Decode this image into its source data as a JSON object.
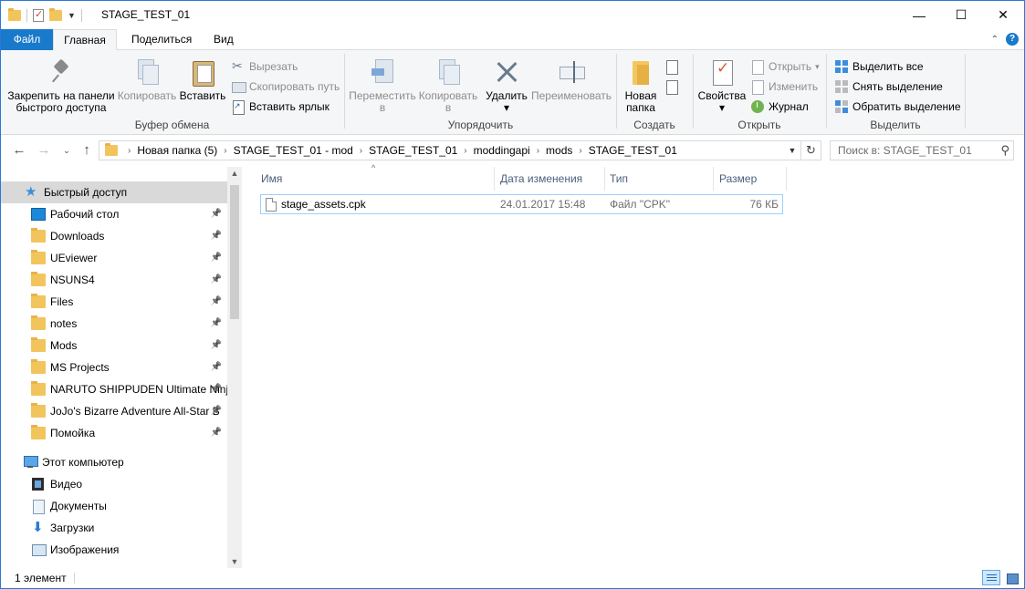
{
  "window": {
    "title": "STAGE_TEST_01",
    "controls": {
      "minimize": "—",
      "maximize": "☐",
      "close": "✕"
    }
  },
  "ribbon_tabs": {
    "file": "Файл",
    "home": "Главная",
    "share": "Поделиться",
    "view": "Вид"
  },
  "ribbon": {
    "clipboard": {
      "label": "Буфер обмена",
      "pin_line1": "Закрепить на панели",
      "pin_line2": "быстрого доступа",
      "copy": "Копировать",
      "paste": "Вставить",
      "cut": "Вырезать",
      "copy_path": "Скопировать путь",
      "paste_shortcut": "Вставить ярлык"
    },
    "organize": {
      "label": "Упорядочить",
      "move_line1": "Переместить",
      "move_line2": "в",
      "copy_line1": "Копировать",
      "copy_line2": "в",
      "delete": "Удалить",
      "rename": "Переименовать"
    },
    "create": {
      "label": "Создать",
      "new_folder_line1": "Новая",
      "new_folder_line2": "папка"
    },
    "open": {
      "label": "Открыть",
      "properties": "Свойства",
      "open": "Открыть",
      "edit": "Изменить",
      "history": "Журнал"
    },
    "select": {
      "label": "Выделить",
      "select_all": "Выделить все",
      "select_none": "Снять выделение",
      "invert": "Обратить выделение"
    }
  },
  "address": {
    "crumbs": [
      "Новая папка (5)",
      "STAGE_TEST_01 - mod",
      "STAGE_TEST_01",
      "moddingapi",
      "mods",
      "STAGE_TEST_01"
    ],
    "search_placeholder": "Поиск в: STAGE_TEST_01"
  },
  "nav_pane": {
    "quick_access": "Быстрый доступ",
    "quick_items": [
      {
        "label": "Рабочий стол",
        "icon": "desktop-icon"
      },
      {
        "label": "Downloads",
        "icon": "folder-icon"
      },
      {
        "label": "UEviewer",
        "icon": "folder-icon"
      },
      {
        "label": "NSUNS4",
        "icon": "folder-icon"
      },
      {
        "label": "Files",
        "icon": "folder-icon"
      },
      {
        "label": "notes",
        "icon": "folder-icon"
      },
      {
        "label": "Mods",
        "icon": "folder-icon"
      },
      {
        "label": "MS Projects",
        "icon": "folder-icon"
      },
      {
        "label": "NARUTO SHIPPUDEN Ultimate Ninja",
        "icon": "folder-icon"
      },
      {
        "label": "JoJo's Bizarre Adventure All-Star B",
        "icon": "folder-icon"
      },
      {
        "label": "Помойка",
        "icon": "folder-icon"
      }
    ],
    "this_pc": "Этот компьютер",
    "pc_items": [
      {
        "label": "Видео",
        "icon": "video-icon"
      },
      {
        "label": "Документы",
        "icon": "documents-icon"
      },
      {
        "label": "Загрузки",
        "icon": "downloads-icon"
      },
      {
        "label": "Изображения",
        "icon": "images-icon"
      }
    ]
  },
  "file_list": {
    "columns": {
      "name": "Имя",
      "date": "Дата изменения",
      "type": "Тип",
      "size": "Размер"
    },
    "rows": [
      {
        "name": "stage_assets.cpk",
        "date": "24.01.2017 15:48",
        "type": "Файл \"CPK\"",
        "size": "76 КБ"
      }
    ]
  },
  "status": {
    "count": "1 элемент"
  }
}
